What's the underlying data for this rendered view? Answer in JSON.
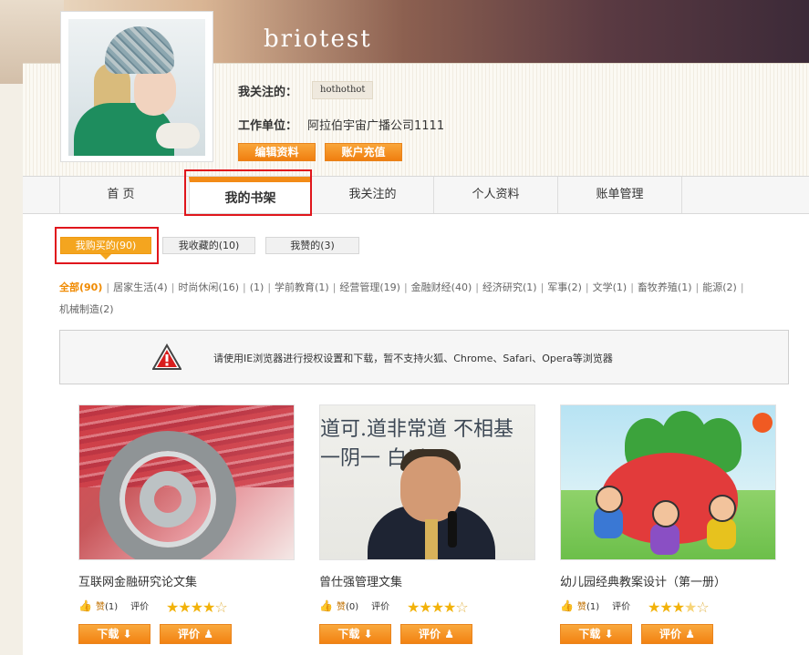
{
  "profile": {
    "username": "briotest",
    "follow_label": "我关注的：",
    "follow_tag": "hothothot",
    "work_label": "工作单位：",
    "work_value": "阿拉伯宇宙广播公司1111",
    "edit_button": "编辑资料",
    "recharge_button": "账户充值"
  },
  "nav": {
    "home": "首 页",
    "shelf": "我的书架",
    "follow": "我关注的",
    "profile": "个人资料",
    "bill": "账单管理"
  },
  "subtabs": {
    "bought": "我购买的(90)",
    "fav": "我收藏的(10)",
    "like": "我赞的(3)"
  },
  "categories": [
    {
      "name": "全部",
      "count": "90"
    },
    {
      "name": "居家生活",
      "count": "4"
    },
    {
      "name": "时尚休闲",
      "count": "16"
    },
    {
      "name": "",
      "count": "1"
    },
    {
      "name": "学前教育",
      "count": "1"
    },
    {
      "name": "经营管理",
      "count": "19"
    },
    {
      "name": "金融财经",
      "count": "40"
    },
    {
      "name": "经济研究",
      "count": "1"
    },
    {
      "name": "军事",
      "count": "2"
    },
    {
      "name": "文学",
      "count": "1"
    },
    {
      "name": "畜牧养殖",
      "count": "1"
    },
    {
      "name": "能源",
      "count": "2"
    },
    {
      "name": "机械制造",
      "count": "2"
    }
  ],
  "notice": "请使用IE浏览器进行授权设置和下载，暂不支持火狐、Chrome、Safari、Opera等浏览器",
  "books": [
    {
      "title": "互联网金融研究论文集",
      "like_label": "赞",
      "like_count": "(1)",
      "rate_label": "评价",
      "rating": 4,
      "download": "下载",
      "review": "评价"
    },
    {
      "title": "曾仕强管理文集",
      "like_label": "赞",
      "like_count": "(0)",
      "rate_label": "评价",
      "rating": 4,
      "download": "下载",
      "review": "评价"
    },
    {
      "title": "幼儿园经典教案设计（第一册）",
      "like_label": "赞",
      "like_count": "(1)",
      "rate_label": "评价",
      "rating": 3.5,
      "download": "下载",
      "review": "评价"
    }
  ],
  "cover2_text": "道可.道非常道 不相基 一阴一 白以乙",
  "colors": {
    "accent": "#f38b17",
    "highlight_box": "#e0161c",
    "star": "#f2b20a"
  },
  "icons": {
    "download": "download-icon",
    "review": "user-icon",
    "like": "thumb-up-icon",
    "warning": "warning-icon"
  }
}
